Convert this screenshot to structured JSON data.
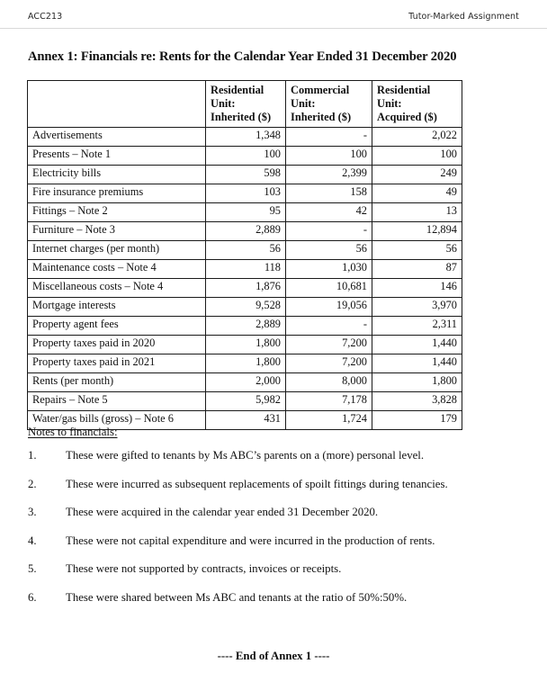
{
  "page_header": {
    "course_code": "ACC213",
    "assignment_label": "Tutor-Marked Assignment"
  },
  "title": "Annex 1: Financials re: Rents for the Calendar Year Ended 31 December 2020",
  "table": {
    "columns": [
      {
        "line1": "",
        "line2": "",
        "line3": ""
      },
      {
        "line1": "Residential",
        "line2": "Unit:",
        "line3": "Inherited ($)"
      },
      {
        "line1": "Commercial",
        "line2": "Unit:",
        "line3": "Inherited ($)"
      },
      {
        "line1": "Residential",
        "line2": "Unit:",
        "line3": "Acquired ($)"
      }
    ],
    "rows": [
      {
        "label": "Advertisements",
        "a": "1,348",
        "b": "-",
        "c": "2,022"
      },
      {
        "label": "Presents – Note 1",
        "a": "100",
        "b": "100",
        "c": "100"
      },
      {
        "label": "Electricity bills",
        "a": "598",
        "b": "2,399",
        "c": "249"
      },
      {
        "label": "Fire insurance premiums",
        "a": "103",
        "b": "158",
        "c": "49"
      },
      {
        "label": "Fittings – Note 2",
        "a": "95",
        "b": "42",
        "c": "13"
      },
      {
        "label": "Furniture – Note 3",
        "a": "2,889",
        "b": "-",
        "c": "12,894"
      },
      {
        "label": "Internet charges (per month)",
        "a": "56",
        "b": "56",
        "c": "56"
      },
      {
        "label": "Maintenance costs – Note 4",
        "a": "118",
        "b": "1,030",
        "c": "87"
      },
      {
        "label": "Miscellaneous costs – Note 4",
        "a": "1,876",
        "b": "10,681",
        "c": "146"
      },
      {
        "label": "Mortgage interests",
        "a": "9,528",
        "b": "19,056",
        "c": "3,970"
      },
      {
        "label": "Property agent fees",
        "a": "2,889",
        "b": "-",
        "c": "2,311"
      },
      {
        "label": "Property taxes paid in 2020",
        "a": "1,800",
        "b": "7,200",
        "c": "1,440"
      },
      {
        "label": "Property taxes paid in 2021",
        "a": "1,800",
        "b": "7,200",
        "c": "1,440"
      },
      {
        "label": "Rents (per month)",
        "a": "2,000",
        "b": "8,000",
        "c": "1,800"
      },
      {
        "label": "Repairs – Note 5",
        "a": "5,982",
        "b": "7,178",
        "c": "3,828"
      },
      {
        "label": "Water/gas bills (gross) – Note 6",
        "a": "431",
        "b": "1,724",
        "c": "179"
      }
    ]
  },
  "notes": {
    "heading": "Notes to financials:",
    "items": [
      {
        "num": "1.",
        "text": "These were gifted to tenants by Ms ABC’s parents on a (more) personal level."
      },
      {
        "num": "2.",
        "text": "These were incurred as subsequent replacements of spoilt fittings during tenancies."
      },
      {
        "num": "3.",
        "text": "These were acquired in the calendar year ended 31 December 2020."
      },
      {
        "num": "4.",
        "text": "These were not capital expenditure and were incurred in the production of rents."
      },
      {
        "num": "5.",
        "text": "These were not supported by contracts, invoices or receipts."
      },
      {
        "num": "6.",
        "text": "These were shared between Ms ABC and tenants at the ratio of 50%:50%."
      }
    ]
  },
  "footer": "---- End of Annex 1 ----"
}
